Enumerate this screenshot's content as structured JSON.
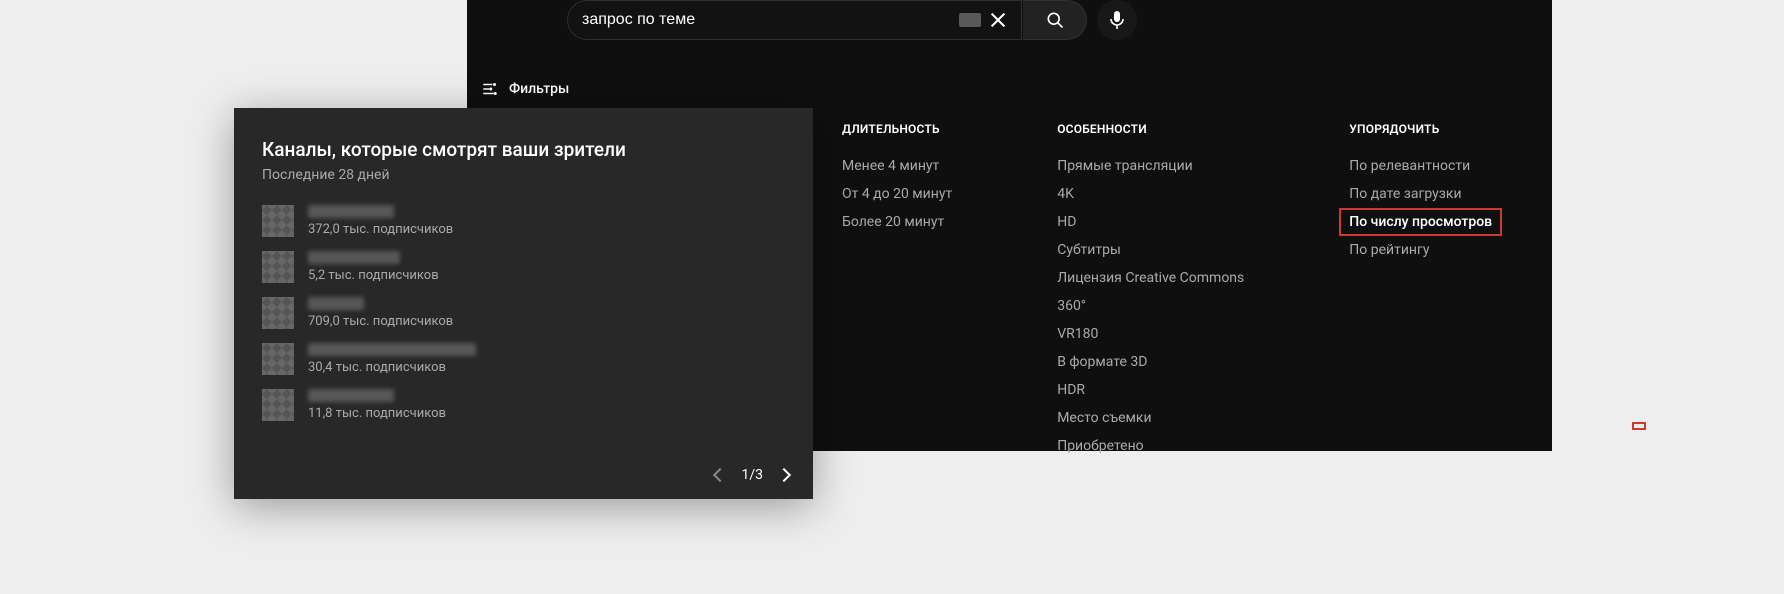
{
  "search": {
    "value": "запрос по теме"
  },
  "filters_label": "Фильтры",
  "filter_columns": {
    "duration": {
      "header": "ДЛИТЕЛЬНОСТЬ",
      "opts": [
        "Менее 4 минут",
        "От 4 до 20 минут",
        "Более 20 минут"
      ]
    },
    "features": {
      "header": "ОСОБЕННОСТИ",
      "opts": [
        "Прямые трансляции",
        "4K",
        "HD",
        "Субтитры",
        "Лицензия Creative Commons",
        "360°",
        "VR180",
        "В формате 3D",
        "HDR",
        "Место съемки",
        "Приобретено"
      ]
    },
    "sort": {
      "header": "УПОРЯДОЧИТЬ",
      "opts": [
        "По релевантности",
        "По дате загрузки",
        "По числу просмотров",
        "По рейтингу"
      ],
      "highlighted_index": 2
    }
  },
  "card": {
    "title": "Каналы, которые смотрят ваши зрители",
    "subtitle": "Последние 28 дней",
    "channels": [
      {
        "name_width": 86,
        "subs": "372,0 тыс. подписчиков"
      },
      {
        "name_width": 92,
        "subs": "5,2 тыс. подписчиков"
      },
      {
        "name_width": 56,
        "subs": "709,0 тыс. подписчиков"
      },
      {
        "name_width": 168,
        "subs": "30,4 тыс. подписчиков"
      },
      {
        "name_width": 86,
        "subs": "11,8 тыс. подписчиков"
      }
    ],
    "pager": "1/3"
  }
}
